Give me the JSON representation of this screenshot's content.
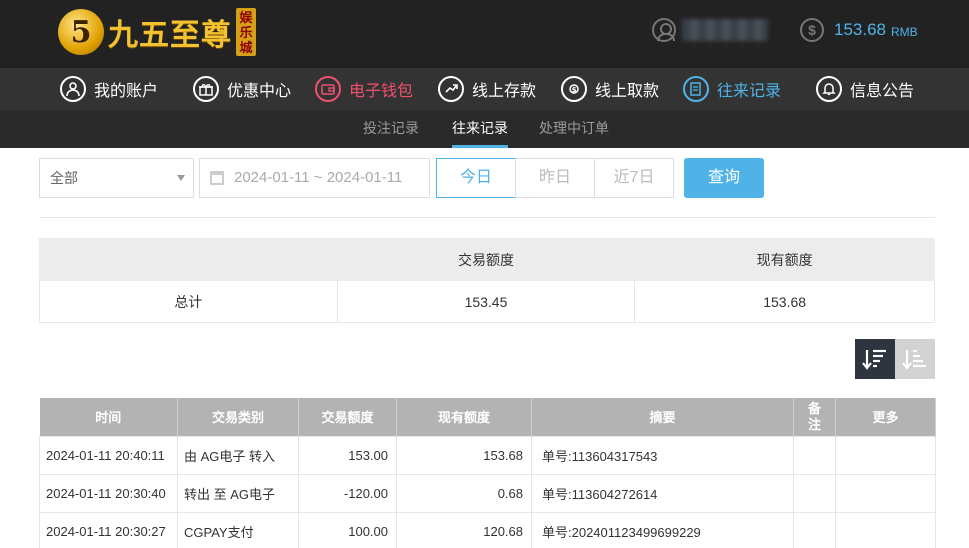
{
  "header": {
    "logo_digit": "5",
    "logo_text": "九五至尊",
    "logo_sub": [
      "娱",
      "乐",
      "城"
    ],
    "balance_symbol": "$",
    "balance": "153.68",
    "balance_unit": "RMB"
  },
  "nav": {
    "items": [
      {
        "label": "我的账户",
        "icon": "user-icon"
      },
      {
        "label": "优惠中心",
        "icon": "gift-icon"
      },
      {
        "label": "电子钱包",
        "icon": "wallet-icon"
      },
      {
        "label": "线上存款",
        "icon": "deposit-icon"
      },
      {
        "label": "线上取款",
        "icon": "withdraw-icon"
      },
      {
        "label": "往来记录",
        "icon": "records-icon"
      },
      {
        "label": "信息公告",
        "icon": "bell-icon"
      }
    ],
    "colors": {
      "active_red": "#f0506e",
      "active_blue": "#4fb3e8"
    }
  },
  "subnav": {
    "items": [
      "投注记录",
      "往来记录",
      "处理中订单"
    ],
    "active": "往来记录"
  },
  "filter": {
    "type_value": "全部",
    "date_range": "2024-01-11 ~ 2024-01-11",
    "ranges": [
      "今日",
      "昨日",
      "近7日"
    ],
    "active_range": "今日",
    "query_label": "查询"
  },
  "summary": {
    "headers": [
      "",
      "交易额度",
      "现有额度"
    ],
    "row": [
      "总计",
      "153.45",
      "153.68"
    ]
  },
  "records": {
    "headers": [
      "时间",
      "交易类别",
      "交易额度",
      "现有额度",
      "摘要",
      "备注",
      "更多"
    ],
    "rows": [
      [
        "2024-01-11 20:40:11",
        "由 AG电子 转入",
        "153.00",
        "153.68",
        "单号:113604317543",
        "",
        ""
      ],
      [
        "2024-01-11 20:30:40",
        "转出 至 AG电子",
        "-120.00",
        "0.68",
        "单号:113604272614",
        "",
        ""
      ],
      [
        "2024-01-11 20:30:27",
        "CGPAY支付",
        "100.00",
        "120.68",
        "单号:202401123499699229",
        "",
        ""
      ]
    ]
  }
}
